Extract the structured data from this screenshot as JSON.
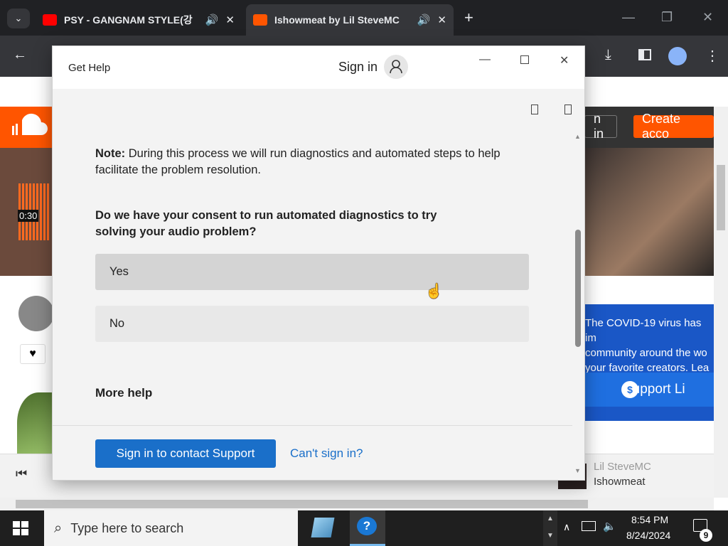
{
  "browser": {
    "tabs": [
      {
        "title": "PSY - GANGNAM STYLE(강",
        "favicon": "youtube-icon",
        "favicon_color": "#ff0000",
        "active": false
      },
      {
        "title": "Ishowmeat by Lil SteveMC",
        "favicon": "soundcloud-icon",
        "favicon_color": "#ff5500",
        "active": true
      }
    ],
    "new_tab": "+"
  },
  "background_page": {
    "sign_in": "n in",
    "create_account": "Create acco",
    "time": "0:30",
    "covid_text": [
      "The COVID-19 virus has im",
      "community around the wo",
      "your favorite creators. Lea"
    ],
    "support_label": "Support Li",
    "player": {
      "artist": "Lil SteveMC",
      "track": "Ishowmeat"
    },
    "accent": "#ff5500"
  },
  "get_help": {
    "app_title": "Get Help",
    "sign_in": "Sign in",
    "note_bold": "Note:",
    "note_text": " During this process we will run diagnostics and automated steps to help facilitate the problem resolution.",
    "question": "Do we have your consent to run automated diagnostics to try solving your audio problem?",
    "options": [
      "Yes",
      "No"
    ],
    "more_help": "More help",
    "contact_button": "Sign in to contact Support",
    "cant_sign_in": "Can't sign in?",
    "accent": "#1a6fc9"
  },
  "taskbar": {
    "search_placeholder": "Type here to search",
    "time": "8:54 PM",
    "date": "8/24/2024",
    "notification_count": "9"
  }
}
